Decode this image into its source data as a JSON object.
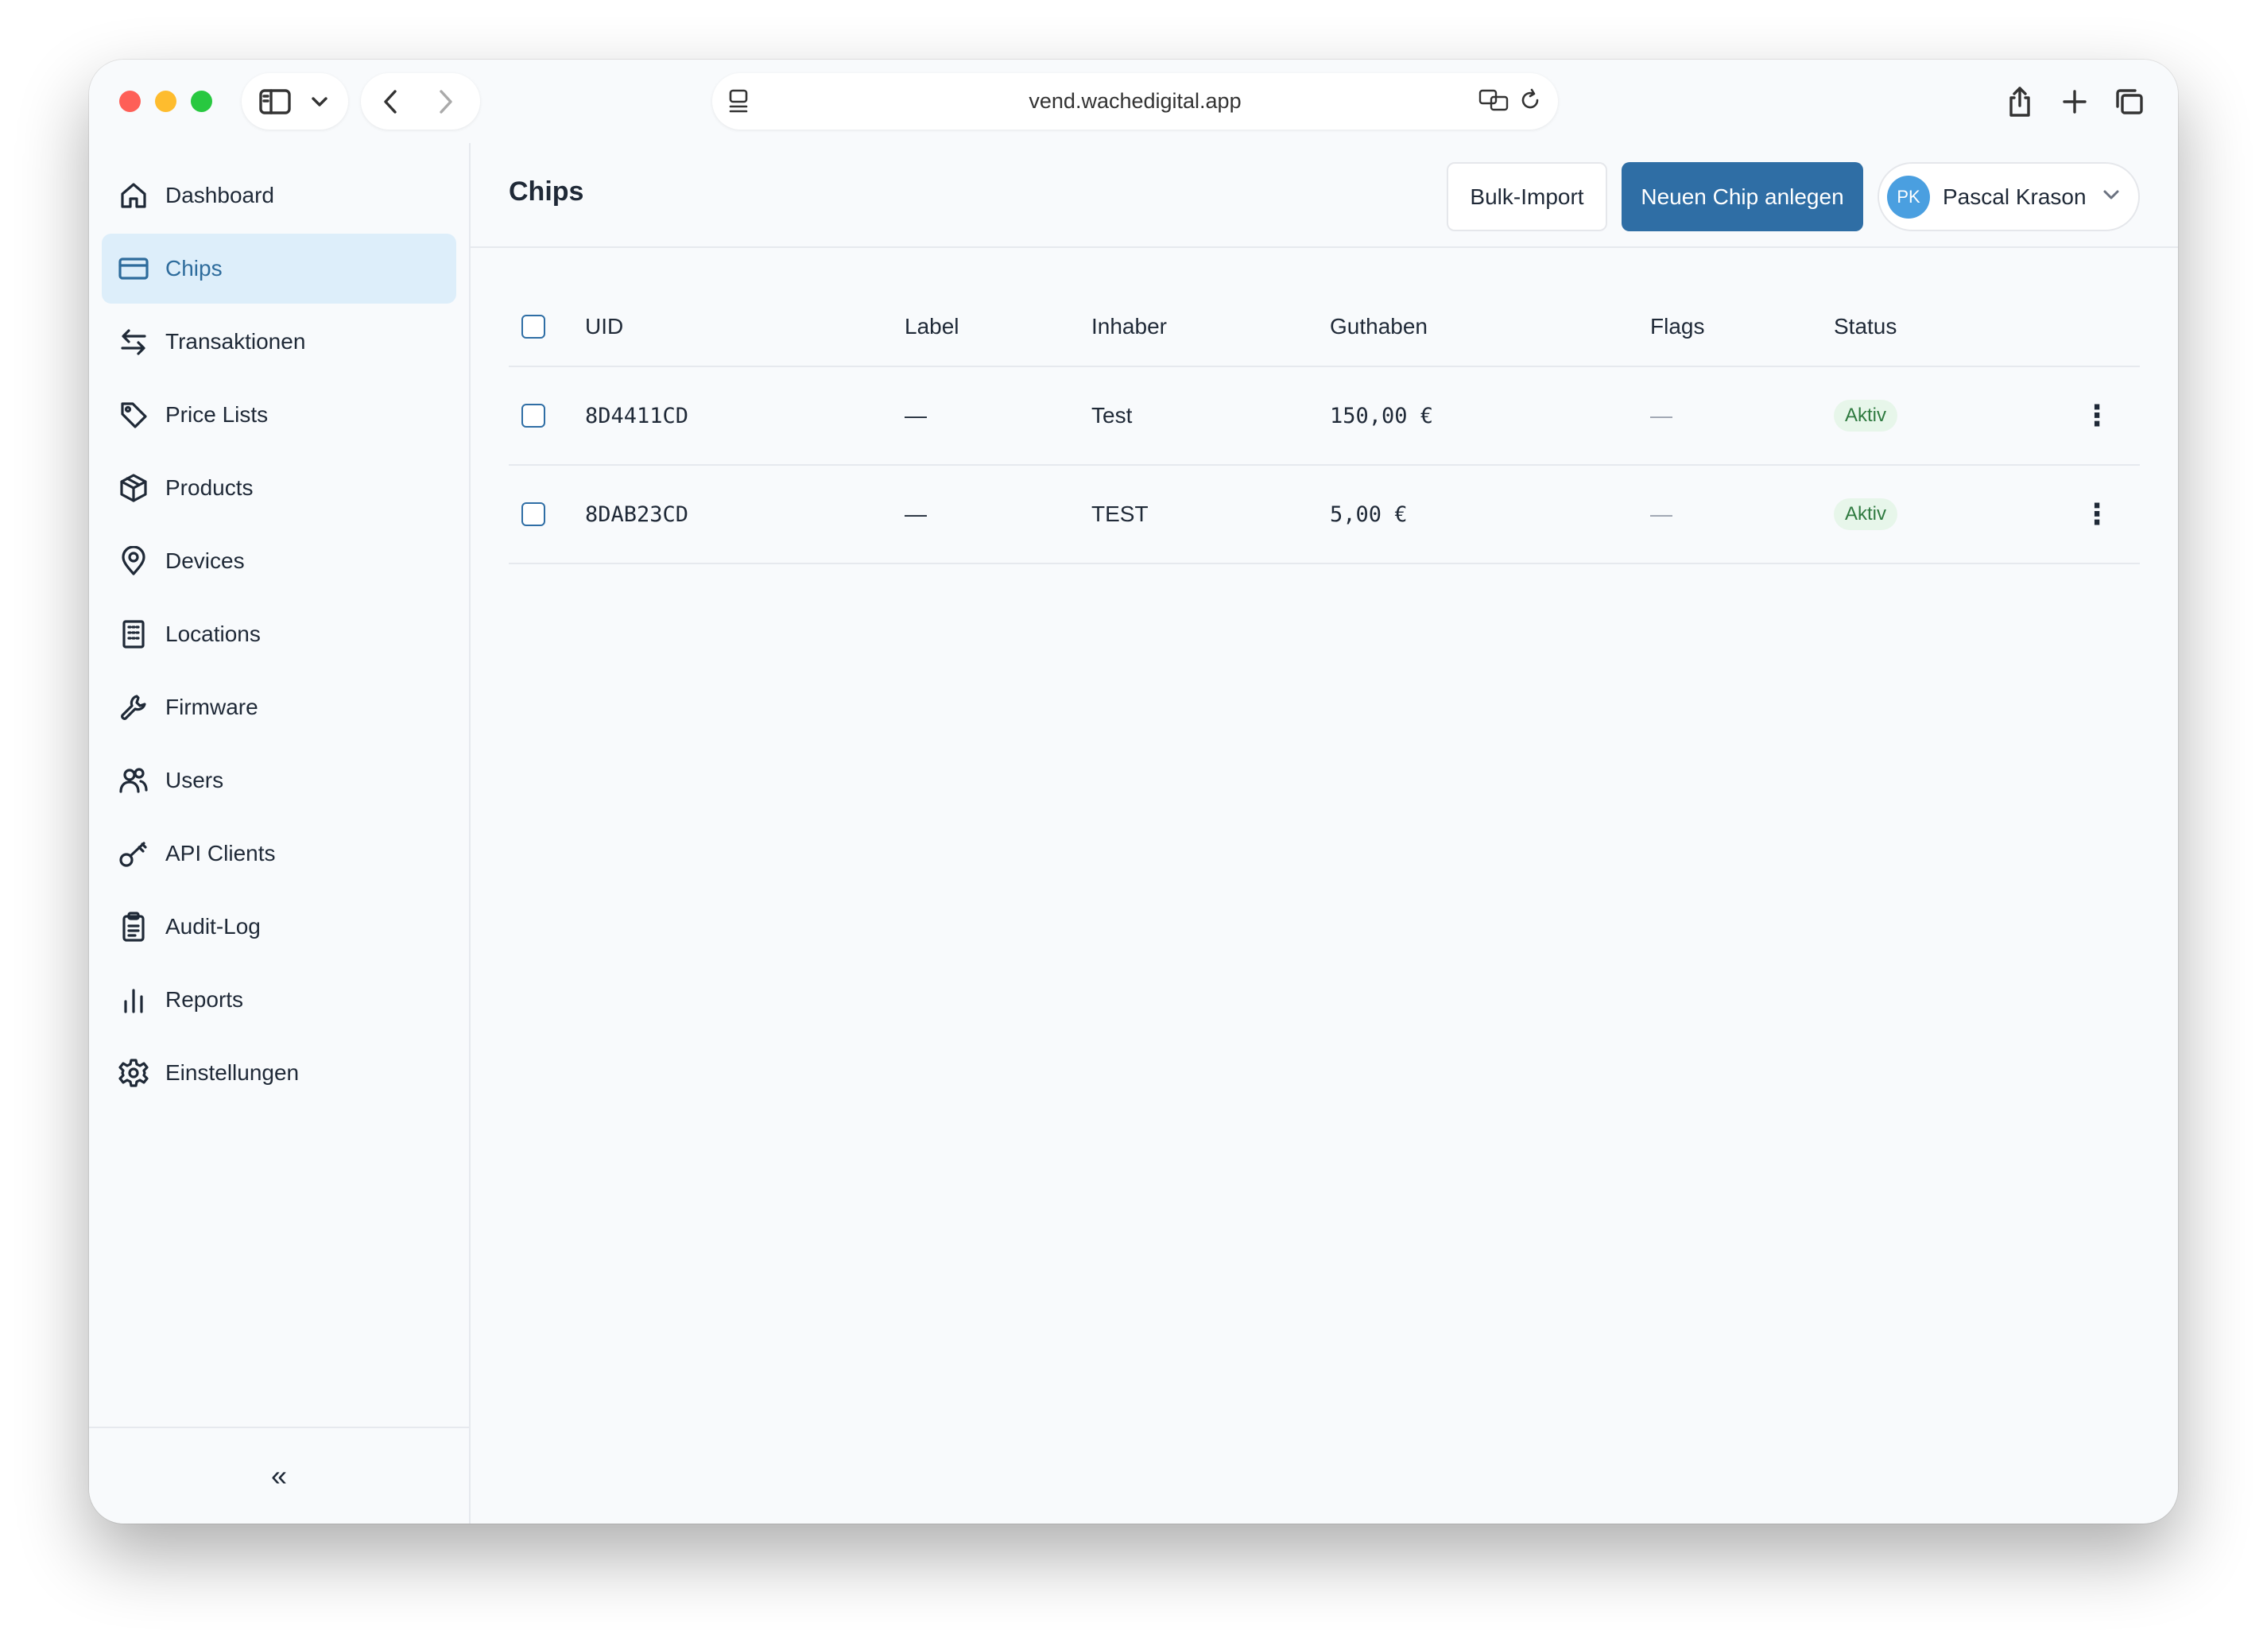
{
  "browser": {
    "url": "vend.wachedigital.app"
  },
  "sidebar": {
    "items": [
      {
        "label": "Dashboard",
        "icon": "home-icon"
      },
      {
        "label": "Chips",
        "icon": "card-icon",
        "active": true
      },
      {
        "label": "Transaktionen",
        "icon": "arrows-icon"
      },
      {
        "label": "Price Lists",
        "icon": "tag-icon"
      },
      {
        "label": "Products",
        "icon": "box-icon"
      },
      {
        "label": "Devices",
        "icon": "map-pin-icon"
      },
      {
        "label": "Locations",
        "icon": "building-icon"
      },
      {
        "label": "Firmware",
        "icon": "wrench-icon"
      },
      {
        "label": "Users",
        "icon": "users-icon"
      },
      {
        "label": "API Clients",
        "icon": "key-icon"
      },
      {
        "label": "Audit-Log",
        "icon": "clipboard-icon"
      },
      {
        "label": "Reports",
        "icon": "bar-chart-icon"
      },
      {
        "label": "Einstellungen",
        "icon": "gear-icon"
      }
    ],
    "collapse_label": "«"
  },
  "header": {
    "title": "Chips",
    "bulk_import_label": "Bulk-Import",
    "new_chip_label": "Neuen Chip anlegen",
    "user": {
      "initials": "PK",
      "name": "Pascal Krason"
    }
  },
  "table": {
    "columns": [
      "UID",
      "Label",
      "Inhaber",
      "Guthaben",
      "Flags",
      "Status"
    ],
    "rows": [
      {
        "uid": "8D4411CD",
        "label": "—",
        "owner": "Test",
        "balance": "150,00 €",
        "flags": "—",
        "status": "Aktiv"
      },
      {
        "uid": "8DAB23CD",
        "label": "—",
        "owner": "TEST",
        "balance": "5,00 €",
        "flags": "—",
        "status": "Aktiv"
      }
    ]
  },
  "colors": {
    "accent": "#2f6ea5",
    "active_nav_bg": "#ddeefa",
    "status_active_bg": "#e7f6ea",
    "status_active_text": "#2f7a40"
  }
}
